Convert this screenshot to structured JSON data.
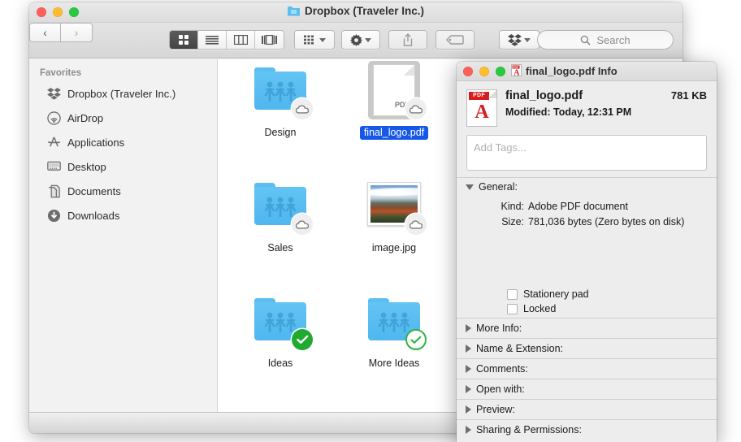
{
  "finder": {
    "window_title": "Dropbox (Traveler Inc.)",
    "title_icon": "folder-icon",
    "traffic_lights": {
      "close": "close-button",
      "minimize": "minimize-button",
      "zoom": "zoom-button"
    },
    "toolbar": {
      "back_label": "‹",
      "forward_label": "›",
      "view_modes": [
        {
          "name": "icon-view",
          "label": "icon",
          "active": true
        },
        {
          "name": "list-view",
          "label": "list",
          "active": false
        },
        {
          "name": "column-view",
          "label": "column",
          "active": false
        },
        {
          "name": "coverflow-view",
          "label": "coverflow",
          "active": false
        }
      ],
      "arrange_button": "arrange-icon",
      "action_button": "gear-icon",
      "share_button": "share-icon",
      "tag_button": "tag-icon",
      "dropbox_button": "dropbox-icon"
    },
    "search": {
      "placeholder": "Search",
      "value": "",
      "icon": "search-icon"
    },
    "sidebar": {
      "header": "Favorites",
      "items": [
        {
          "label": "Dropbox (Traveler Inc.)",
          "icon": "dropbox-icon"
        },
        {
          "label": "AirDrop",
          "icon": "airdrop-icon"
        },
        {
          "label": "Applications",
          "icon": "applications-icon"
        },
        {
          "label": "Desktop",
          "icon": "desktop-icon"
        },
        {
          "label": "Documents",
          "icon": "documents-icon"
        },
        {
          "label": "Downloads",
          "icon": "downloads-icon"
        }
      ]
    },
    "files": [
      {
        "name": "Design",
        "type": "shared-folder",
        "badge": "cloud",
        "selected": false
      },
      {
        "name": "final_logo.pdf",
        "type": "pdf",
        "badge": "cloud",
        "selected": true
      },
      {
        "name": "Sales",
        "type": "shared-folder",
        "badge": "cloud",
        "selected": false
      },
      {
        "name": "image.jpg",
        "type": "photo",
        "badge": "cloud",
        "selected": false
      },
      {
        "name": "Ideas",
        "type": "shared-folder",
        "badge": "check-solid",
        "selected": false
      },
      {
        "name": "More Ideas",
        "type": "shared-folder",
        "badge": "check-open",
        "selected": false
      }
    ]
  },
  "info_window": {
    "title": "final_logo.pdf Info",
    "title_icon": "pdf-icon",
    "file_name": "final_logo.pdf",
    "file_size": "781 KB",
    "modified_label": "Modified:",
    "modified_value": "Today, 12:31 PM",
    "tags_placeholder": "Add Tags...",
    "tags_value": "",
    "general": {
      "header": "General:",
      "rows": [
        {
          "key": "Kind:",
          "value": "Adobe PDF document"
        },
        {
          "key": "Size:",
          "value": "781,036 bytes (Zero bytes on disk)"
        }
      ],
      "checkboxes": [
        {
          "label": "Stationery pad",
          "checked": false
        },
        {
          "label": "Locked",
          "checked": false
        }
      ]
    },
    "sections": [
      {
        "label": "More Info:",
        "expanded": false
      },
      {
        "label": "Name & Extension:",
        "expanded": false
      },
      {
        "label": "Comments:",
        "expanded": false
      },
      {
        "label": "Open with:",
        "expanded": false
      },
      {
        "label": "Preview:",
        "expanded": false
      },
      {
        "label": "Sharing & Permissions:",
        "expanded": false
      }
    ]
  },
  "colors": {
    "selection_blue": "#1558e8",
    "folder_blue": "#4fb6ef",
    "badge_green": "#1eab30",
    "pdf_red": "#d91c1c",
    "traffic_red": "#fe5f57",
    "traffic_yellow": "#febc2e",
    "traffic_green": "#28c840"
  }
}
